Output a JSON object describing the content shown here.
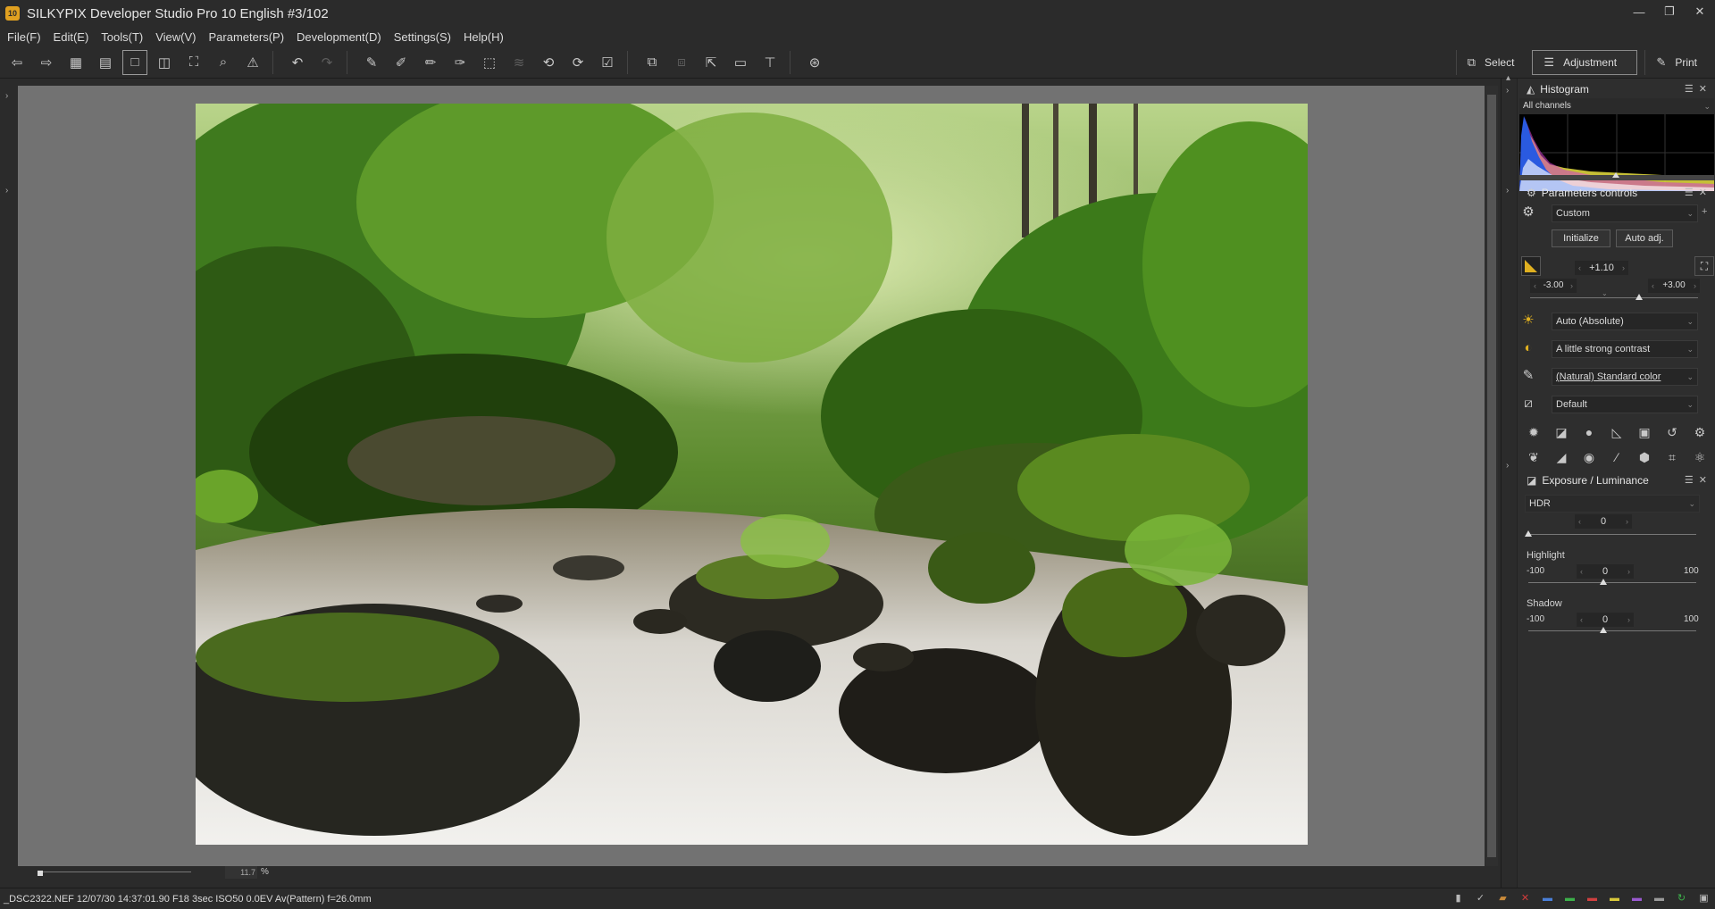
{
  "window": {
    "title": "SILKYPIX Developer Studio Pro 10 English   #3/102",
    "icon_text": "10",
    "controls": [
      "minimize",
      "restore",
      "close"
    ]
  },
  "menu": [
    "File(F)",
    "Edit(E)",
    "Tools(T)",
    "View(V)",
    "Parameters(P)",
    "Development(D)",
    "Settings(S)",
    "Help(H)"
  ],
  "toolbar": {
    "buttons": [
      {
        "name": "prev-image-icon",
        "glyph": "⇦"
      },
      {
        "name": "next-image-icon",
        "glyph": "⇨"
      },
      {
        "name": "thumbnail-view-icon",
        "glyph": "▦"
      },
      {
        "name": "preview-thumbnail-view-icon",
        "glyph": "▤"
      },
      {
        "name": "preview-view-icon",
        "glyph": "□"
      },
      {
        "name": "compare-view-icon",
        "glyph": "◫"
      },
      {
        "name": "fullscreen-icon",
        "glyph": "⛶"
      },
      {
        "name": "zoom-icon",
        "glyph": "⌕"
      },
      {
        "name": "warning-icon",
        "glyph": "⚠"
      },
      {
        "name": "undo-icon",
        "glyph": "↶"
      },
      {
        "name": "redo-icon",
        "glyph": "↷"
      },
      {
        "name": "copy-params-icon",
        "glyph": "✎"
      },
      {
        "name": "paste-params-icon",
        "glyph": "✐"
      },
      {
        "name": "mark-icon",
        "glyph": "✏"
      },
      {
        "name": "compare-marks-icon",
        "glyph": "✑"
      },
      {
        "name": "transform-icon",
        "glyph": "⬚"
      },
      {
        "name": "layers-icon",
        "glyph": "≋"
      },
      {
        "name": "rotate-left-icon",
        "glyph": "⟲"
      },
      {
        "name": "rotate-right-icon",
        "glyph": "⟳"
      },
      {
        "name": "check-icon",
        "glyph": "☑"
      },
      {
        "name": "develop-icon",
        "glyph": "⧉"
      },
      {
        "name": "batch-develop-icon",
        "glyph": "⧈"
      },
      {
        "name": "export-icon",
        "glyph": "⇱"
      },
      {
        "name": "display-icon",
        "glyph": "▭"
      },
      {
        "name": "ruler-icon",
        "glyph": "⊤"
      },
      {
        "name": "inspect-icon",
        "glyph": "⊛"
      }
    ],
    "active_button": "preview-view-icon",
    "dim_buttons": [
      "redo-icon",
      "batch-develop-icon",
      "layers-icon"
    ]
  },
  "mode_tabs": [
    {
      "label": "Select",
      "icon": "select-icon",
      "glyph": "⧉"
    },
    {
      "label": "Adjustment",
      "icon": "adjustment-icon",
      "glyph": "☰",
      "active": true
    },
    {
      "label": "Print",
      "icon": "print-icon",
      "glyph": "✎"
    }
  ],
  "viewer": {
    "zoom_value": "11.7",
    "zoom_unit": "%"
  },
  "status": {
    "text": "_DSC2322.NEF 12/07/30 14:37:01.90 F18 3sec ISO50  0.0EV Av(Pattern) f=26.0mm",
    "icons": [
      {
        "name": "layout-icon",
        "glyph": "▮",
        "color": "#b8b8b8"
      },
      {
        "name": "check-mark-icon",
        "glyph": "✓",
        "color": "#b8b8b8"
      },
      {
        "name": "folder-icon",
        "glyph": "▰",
        "color": "#c98a3a"
      },
      {
        "name": "delete-icon",
        "glyph": "✕",
        "color": "#d23c3c"
      },
      {
        "name": "tag-blue-icon",
        "glyph": "▬",
        "color": "#4a7fd8"
      },
      {
        "name": "tag-green-icon",
        "glyph": "▬",
        "color": "#3cb04a"
      },
      {
        "name": "tag-red-icon",
        "glyph": "▬",
        "color": "#d04040"
      },
      {
        "name": "tag-yellow-icon",
        "glyph": "▬",
        "color": "#d8c83a"
      },
      {
        "name": "tag-purple-icon",
        "glyph": "▬",
        "color": "#9a5ad0"
      },
      {
        "name": "tag-gray-icon",
        "glyph": "▬",
        "color": "#9a9a9a"
      },
      {
        "name": "refresh-icon",
        "glyph": "↻",
        "color": "#3cb04a"
      },
      {
        "name": "lock-icon",
        "glyph": "▣",
        "color": "#b8b8b8"
      }
    ]
  },
  "histogram": {
    "title": "Histogram",
    "channel": "All channels"
  },
  "params": {
    "title": "Parameters controls",
    "preset": "Custom",
    "initialize": "Initialize",
    "auto_adj": "Auto adj.",
    "exposure_value": "+1.10",
    "range_min": "-3.00",
    "range_max": "+3.00",
    "white_balance": "Auto (Absolute)",
    "contrast": "A little strong contrast",
    "color": "(Natural) Standard color",
    "sharpness": "Default",
    "tool_icons_row1": [
      {
        "name": "brightness-icon",
        "glyph": "✹"
      },
      {
        "name": "exposure-bias-icon",
        "glyph": "◪"
      },
      {
        "name": "sphere-icon",
        "glyph": "●"
      },
      {
        "name": "fine-color-icon",
        "glyph": "◺"
      },
      {
        "name": "frame-icon",
        "glyph": "▣"
      },
      {
        "name": "rotate-icon",
        "glyph": "↺"
      },
      {
        "name": "heal-icon",
        "glyph": "⚙"
      }
    ],
    "tool_icons_row2": [
      {
        "name": "drop-icon",
        "glyph": "❦"
      },
      {
        "name": "gradient-icon",
        "glyph": "◢"
      },
      {
        "name": "lens-icon",
        "glyph": "◉"
      },
      {
        "name": "brush-icon",
        "glyph": "∕"
      },
      {
        "name": "stamp-icon",
        "glyph": "⬢"
      },
      {
        "name": "crop-icon",
        "glyph": "⌗"
      },
      {
        "name": "noise-icon",
        "glyph": "⚛"
      }
    ]
  },
  "exposure": {
    "title": "Exposure / Luminance",
    "hdr_label": "HDR",
    "hdr_value": "0",
    "highlight_label": "Highlight",
    "highlight_value": "0",
    "shadow_label": "Shadow",
    "shadow_value": "0",
    "min": "-100",
    "max": "100"
  }
}
